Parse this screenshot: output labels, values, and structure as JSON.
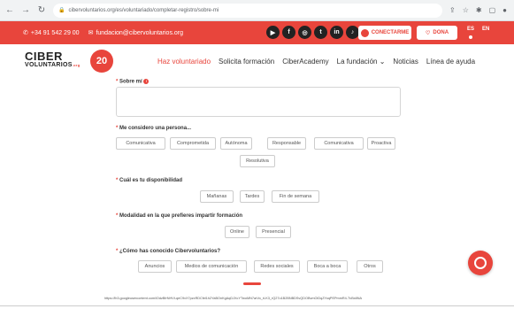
{
  "browser": {
    "url": "cibervoluntarios.org/es/voluntariado/completar-registro/sobre-mi"
  },
  "topbar": {
    "phone": "+34 91 542 29 00",
    "email": "fundacion@cibervoluntarios.org",
    "social_icons": [
      "youtube",
      "facebook",
      "instagram",
      "twitter",
      "linkedin",
      "tiktok"
    ],
    "connect_label": "CONECTARME",
    "donate_label": "DONA",
    "lang_es": "ES",
    "lang_en": "EN"
  },
  "header": {
    "logo_line1": "CIBER",
    "logo_line2": "VOLUNTARIOS",
    "logo_org": ".org",
    "badge": "20",
    "nav": [
      "Haz voluntariado",
      "Solicita formación",
      "CiberAcademy",
      "La fundación",
      "Noticias",
      "Línea de ayuda"
    ],
    "nav_dropdown_glyph": "⌄"
  },
  "form": {
    "about_label": "Sobre mí",
    "persona_label": "Me considero una persona...",
    "persona_options": [
      "Comunicativa",
      "Comprometida",
      "Autónoma",
      "Responsable",
      "Comunicativa",
      "Proactiva",
      "Resolutiva"
    ],
    "availability_label": "Cuál es tu disponibilidad",
    "availability_options": [
      "Mañanas",
      "Tardes",
      "Fin de semana"
    ],
    "modality_label": "Modalidad en la que prefieres impartir formación",
    "modality_options": [
      "Online",
      "Presencial"
    ],
    "source_label": "¿Cómo has conocido Cibervoluntarios?",
    "source_options": [
      "Anuncios",
      "Medios de comunicación",
      "Redes sociales",
      "Boca a boca",
      "Otros"
    ]
  },
  "footer": {
    "url": "https://lh3.googleusercontent.com/lOdzBfrNHVt-qeC9vX7pzxRDCfel1h2YaBOnKgAqDJXcYTwoMN7arVo_rLK3_rQ27o1B2BNBDSvQDOBvmOiDqZYoqPEPmmR4-TvBx8NA",
    "accent": "#e8453c"
  }
}
